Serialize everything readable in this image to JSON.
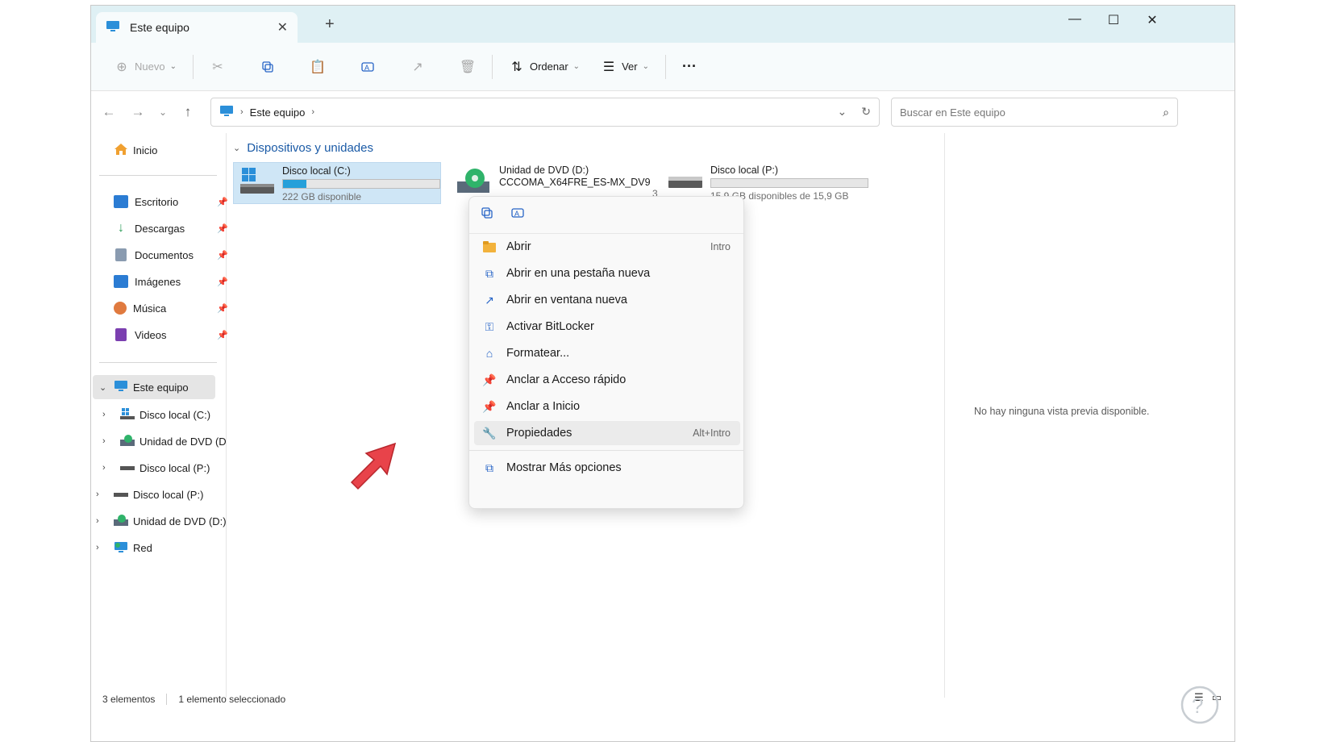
{
  "window": {
    "tab_title": "Este equipo",
    "tab_close": "✕",
    "new_tab": "+",
    "minimize": "—",
    "maximize": "☐",
    "close": "✕"
  },
  "toolbar": {
    "new_label": "Nuevo",
    "sort_label": "Ordenar",
    "view_label": "Ver",
    "more_label": "···"
  },
  "address": {
    "location": "Este equipo",
    "sep1": "›",
    "sep2": "›"
  },
  "search": {
    "placeholder": "Buscar en Este equipo"
  },
  "sidebar": {
    "home": "Inicio",
    "quick_access": [
      {
        "label": "Escritorio",
        "icon": "desktop-icon",
        "color": "#2b7cd3"
      },
      {
        "label": "Descargas",
        "icon": "download-icon",
        "color": "#2e9e59"
      },
      {
        "label": "Documentos",
        "icon": "document-icon",
        "color": "#8a9bb0"
      },
      {
        "label": "Imágenes",
        "icon": "pictures-icon",
        "color": "#2b7cd3"
      },
      {
        "label": "Música",
        "icon": "music-icon",
        "color": "#e07a3f"
      },
      {
        "label": "Videos",
        "icon": "video-icon",
        "color": "#7b3fb0"
      }
    ],
    "this_pc": "Este equipo",
    "tree": [
      {
        "label": "Disco local (C:)",
        "icon": "windows-drive-icon"
      },
      {
        "label": "Unidad de DVD (D",
        "icon": "dvd-icon"
      },
      {
        "label": "Disco local (P:)",
        "icon": "drive-icon"
      }
    ],
    "roots": [
      {
        "label": "Disco local (P:)",
        "icon": "drive-icon"
      },
      {
        "label": "Unidad de DVD (D:)",
        "icon": "dvd-icon"
      },
      {
        "label": "Red",
        "icon": "network-icon"
      }
    ]
  },
  "main": {
    "group_title": "Dispositivos y unidades",
    "drives": [
      {
        "name": "Disco local (C:)",
        "sub": "222 GB disponible",
        "used_fraction": 0.15
      },
      {
        "name": "Unidad de DVD (D:)",
        "sub": "CCCOMA_X64FRE_ES-MX_DV9",
        "sub2": "3"
      },
      {
        "name": "Disco local (P:)",
        "sub": "15,9 GB disponibles de 15,9 GB",
        "used_fraction": 0.0
      }
    ]
  },
  "context_menu": {
    "items": [
      {
        "label": "Abrir",
        "shortcut": "Intro",
        "icon": "folder-open-icon"
      },
      {
        "label": "Abrir en una pestaña nueva",
        "shortcut": "",
        "icon": "new-tab-icon"
      },
      {
        "label": "Abrir en ventana nueva",
        "shortcut": "",
        "icon": "new-window-icon"
      },
      {
        "label": "Activar BitLocker",
        "shortcut": "",
        "icon": "bitlocker-icon"
      },
      {
        "label": "Formatear...",
        "shortcut": "",
        "icon": "format-icon"
      },
      {
        "label": "Anclar a Acceso rápido",
        "shortcut": "",
        "icon": "pin-icon"
      },
      {
        "label": "Anclar a Inicio",
        "shortcut": "",
        "icon": "pin-icon"
      },
      {
        "label": "Propiedades",
        "shortcut": "Alt+Intro",
        "icon": "wrench-icon"
      },
      {
        "label": "Mostrar Más opciones",
        "shortcut": "",
        "icon": "more-options-icon"
      }
    ]
  },
  "preview": {
    "message": "No hay ninguna vista previa disponible."
  },
  "status": {
    "count": "3 elementos",
    "selection": "1 elemento seleccionado"
  }
}
